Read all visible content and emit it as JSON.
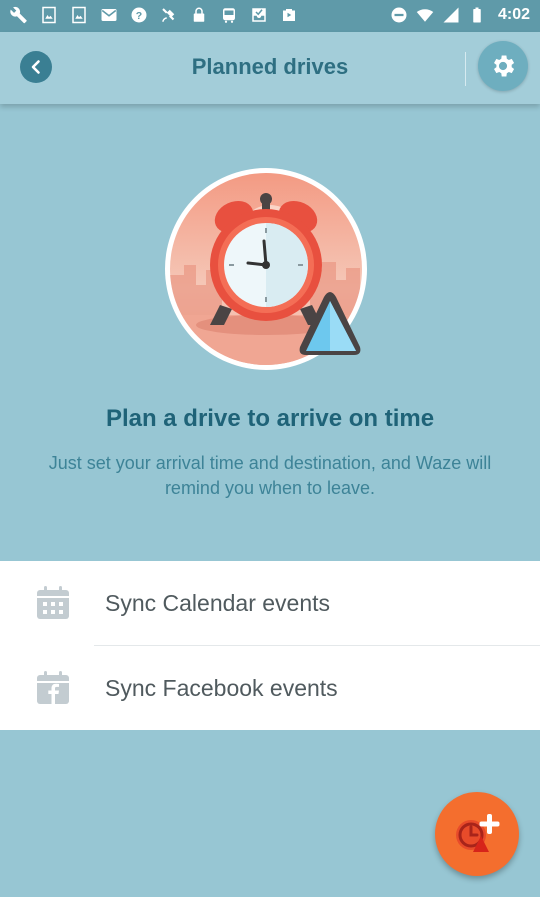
{
  "status_bar": {
    "time": "4:02",
    "icons_left": [
      "wrench-icon",
      "image-icon",
      "image-icon",
      "mail-icon",
      "help-circle-icon",
      "satellite-icon",
      "lock-icon",
      "bus-icon",
      "inbox-icon",
      "play-store-icon"
    ],
    "icons_right": [
      "do-not-disturb-icon",
      "wifi-icon",
      "signal-icon",
      "battery-icon"
    ]
  },
  "app_bar": {
    "title": "Planned drives",
    "back_icon": "chevron-left-icon",
    "settings_icon": "gear-icon"
  },
  "hero": {
    "headline": "Plan a drive to arrive on time",
    "subtext": "Just set your arrival time and destination, and Waze will remind you when to leave."
  },
  "sync": {
    "items": [
      {
        "label": "Sync Calendar events",
        "icon": "calendar-icon"
      },
      {
        "label": "Sync Facebook events",
        "icon": "facebook-calendar-icon"
      }
    ]
  },
  "fab": {
    "icon": "add-planned-drive-icon"
  },
  "colors": {
    "background": "#97c6d3",
    "app_bar": "#a3cdd9",
    "title": "#2e6f82",
    "headline": "#1f6378",
    "fab": "#f46e2e"
  }
}
